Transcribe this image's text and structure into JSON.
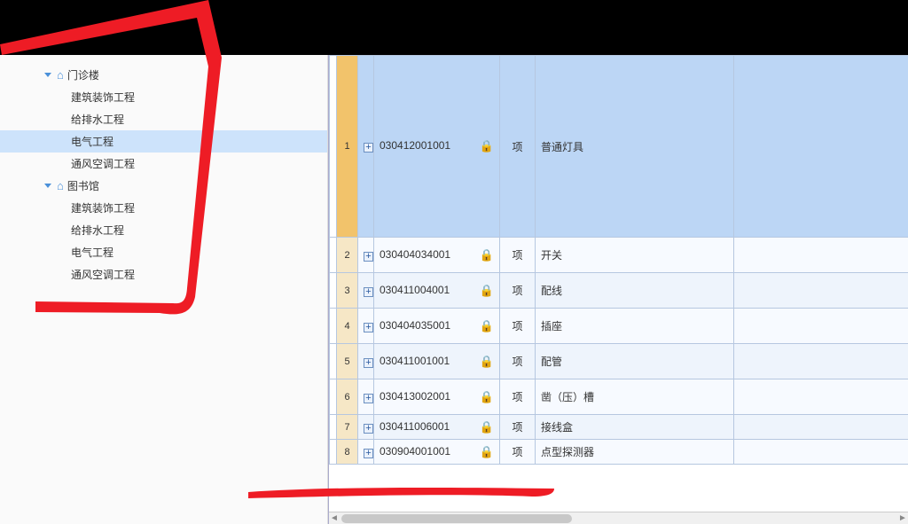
{
  "sidebar": {
    "nodes": [
      {
        "label": "门诊楼",
        "type": "root"
      },
      {
        "label": "建筑装饰工程",
        "type": "child"
      },
      {
        "label": "给排水工程",
        "type": "child"
      },
      {
        "label": "电气工程",
        "type": "child",
        "selected": true
      },
      {
        "label": "通风空调工程",
        "type": "child"
      },
      {
        "label": "图书馆",
        "type": "root"
      },
      {
        "label": "建筑装饰工程",
        "type": "child"
      },
      {
        "label": "给排水工程",
        "type": "child"
      },
      {
        "label": "电气工程",
        "type": "child"
      },
      {
        "label": "通风空调工程",
        "type": "child"
      }
    ]
  },
  "grid": {
    "rows": [
      {
        "num": "1",
        "code": "030412001001",
        "unit": "项",
        "name": "普通灯具",
        "selected": true,
        "tall": true
      },
      {
        "num": "2",
        "code": "030404034001",
        "unit": "项",
        "name": "开关"
      },
      {
        "num": "3",
        "code": "030411004001",
        "unit": "项",
        "name": "配线"
      },
      {
        "num": "4",
        "code": "030404035001",
        "unit": "项",
        "name": "插座"
      },
      {
        "num": "5",
        "code": "030411001001",
        "unit": "项",
        "name": "配管"
      },
      {
        "num": "6",
        "code": "030413002001",
        "unit": "项",
        "name": "凿（压）槽"
      },
      {
        "num": "7",
        "code": "030411006001",
        "unit": "项",
        "name": "接线盒",
        "short": true
      },
      {
        "num": "8",
        "code": "030904001001",
        "unit": "项",
        "name": "点型探测器",
        "short": true
      }
    ]
  },
  "icons": {
    "home": "⌂",
    "lock": "🔒",
    "plus": "+"
  }
}
